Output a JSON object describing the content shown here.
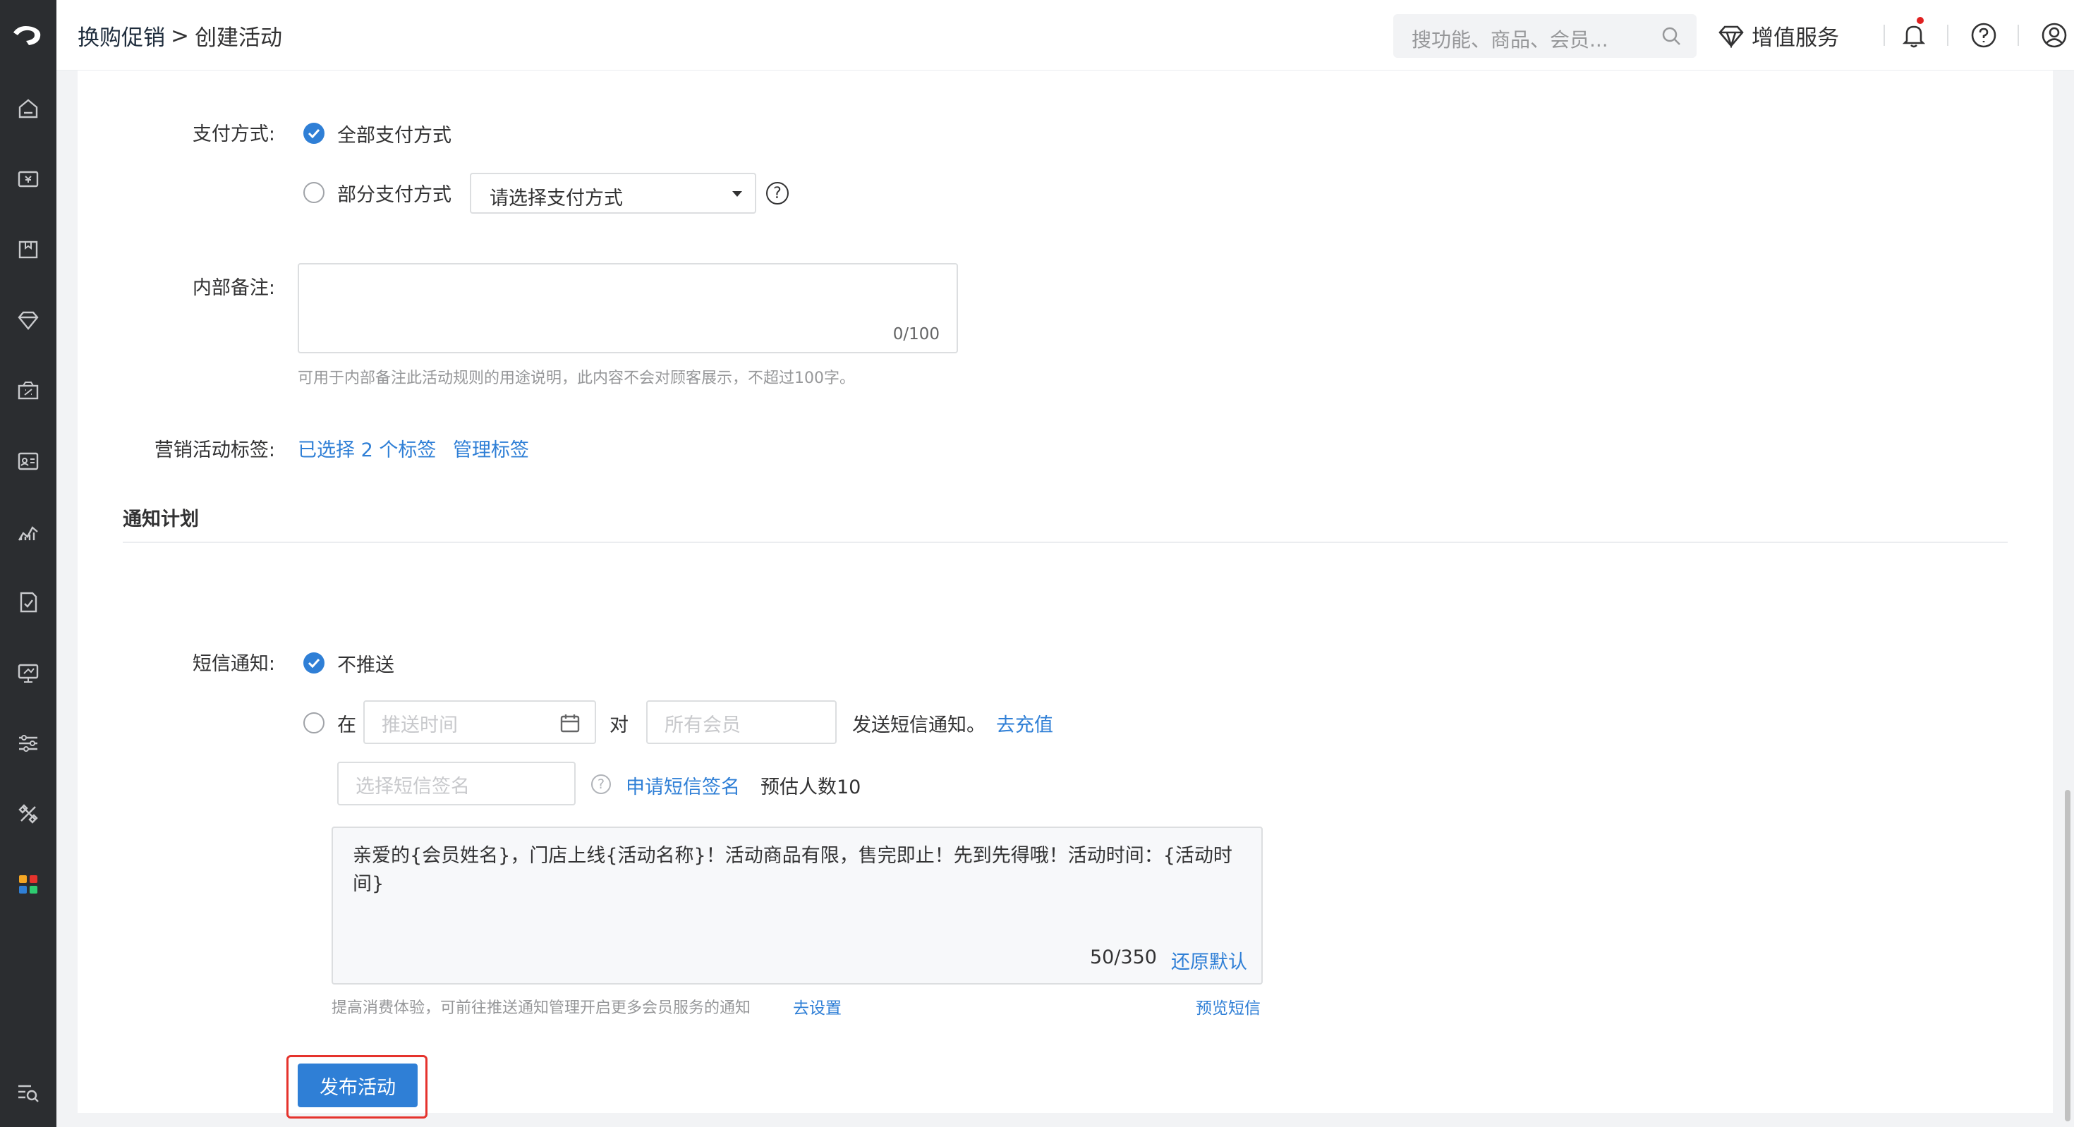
{
  "header": {
    "breadcrumb_parent": "换购促销",
    "breadcrumb_sep": ">",
    "breadcrumb_current": "创建活动",
    "search_placeholder": "搜功能、商品、会员...",
    "value_added": "增值服务"
  },
  "sidebar": {
    "icons": [
      "home-icon",
      "shop-icon",
      "goods-icon",
      "member-icon",
      "marketing-icon",
      "customer-icon",
      "data-icon",
      "finance-icon",
      "store-icon",
      "settings-icon",
      "apps-icon",
      "plugin-icon",
      "search-menu-icon"
    ]
  },
  "form": {
    "payment": {
      "label": "支付方式:",
      "option_all": "全部支付方式",
      "option_partial": "部分支付方式",
      "select_placeholder": "请选择支付方式",
      "help": "?"
    },
    "remark": {
      "label": "内部备注:",
      "counter": "0/100",
      "hint": "可用于内部备注此活动规则的用途说明，此内容不会对顾客展示，不超过100字。"
    },
    "tags": {
      "label": "营销活动标签:",
      "selected": "已选择 2 个标签",
      "manage": "管理标签"
    }
  },
  "notify": {
    "title": "通知计划",
    "sms_label": "短信通知:",
    "no_push": "不推送",
    "at": "在",
    "time_placeholder": "推送时间",
    "to": "对",
    "members_placeholder": "所有会员",
    "send_text": "发送短信通知。",
    "recharge": "去充值",
    "sign_placeholder": "选择短信签名",
    "apply_sign": "申请短信签名",
    "estimate": "预估人数10",
    "sms_content": "亲爱的{会员姓名}，门店上线{活动名称}！活动商品有限，售完即止！先到先得哦！活动时间：{活动时间}",
    "sms_counter": "50/350",
    "restore": "还原默认",
    "tip": "提高消费体验，可前往推送通知管理开启更多会员服务的通知",
    "tip_link": "去设置",
    "preview": "预览短信",
    "help": "?"
  },
  "actions": {
    "publish": "发布活动"
  },
  "colors": {
    "accent": "#2f7fd6",
    "sidebar": "#2b2d30",
    "highlight": "#e5332d"
  }
}
